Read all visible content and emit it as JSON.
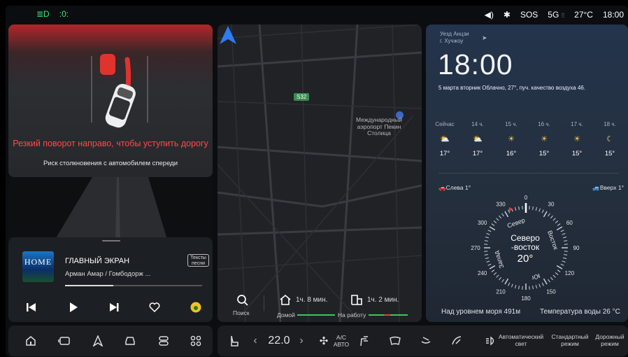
{
  "status_bar": {
    "left_icons": [
      "headlight-icon",
      "parking-light-icon"
    ],
    "sos": "SOS",
    "signal": "5G",
    "temperature": "27°C",
    "time": "18:00"
  },
  "warning": {
    "title": "Резкий поворот направо, чтобы уступить дорогу",
    "subtitle": "Риск столкновения с автомобилем спереди"
  },
  "music": {
    "album_art_text": "HOME",
    "title": "ГЛАВНЫЙ ЭКРАН",
    "artist": "Арман Амар / Гомбодорж ...",
    "lyrics_button": "Тексты песни",
    "progress": 0.35
  },
  "map": {
    "road_badge": "S32",
    "airport_label": "Международный аэропорт Пекин Столица",
    "search_label": "Поиск",
    "home_label": "Домой",
    "home_time": "1ч. 8 мин.",
    "work_label": "На работу",
    "work_time": "1ч. 2 мин."
  },
  "weather": {
    "location_line1": "Уезд Анцзи",
    "location_line2": "г. Хучжоу",
    "time": "18:00",
    "description": "5 марта вторник Облачно, 27°, пуч. качество воздуха 46.",
    "hourly": [
      {
        "label": "Сейчас",
        "icon": "cloud-sun-icon",
        "temp": "17°"
      },
      {
        "label": "14 ч.",
        "icon": "cloud-sun-icon",
        "temp": "17°"
      },
      {
        "label": "15 ч.",
        "icon": "sun-icon",
        "temp": "16°"
      },
      {
        "label": "16 ч.",
        "icon": "sun-icon",
        "temp": "15°"
      },
      {
        "label": "17 ч.",
        "icon": "sun-icon",
        "temp": "15°"
      },
      {
        "label": "18 ч.",
        "icon": "moon-icon",
        "temp": "15°"
      }
    ],
    "left_slope": "Слева 1°",
    "up_slope": "Вверх 1°",
    "compass": {
      "heading": "Северо -восток",
      "degrees": "20°",
      "north": "Север",
      "east": "Восток",
      "south": "Юг",
      "west": "Запад",
      "ticks": [
        "0",
        "30",
        "60",
        "90",
        "120",
        "150",
        "180",
        "210",
        "240",
        "270",
        "300",
        "330"
      ]
    },
    "altitude": "Над уровнем моря 491м",
    "water_temp": "Температура воды  26 °C"
  },
  "dock": {
    "left_icons": [
      "home-icon",
      "screen-icon",
      "navigation-icon",
      "car-icon",
      "settings-icon",
      "apps-icon"
    ],
    "seat_temp": "22.0",
    "ac_label": "A/C АВТО",
    "auto_light": "Автоматический свет",
    "standard_mode": "Стандартный режим",
    "road_mode": "Дорожный режим"
  }
}
